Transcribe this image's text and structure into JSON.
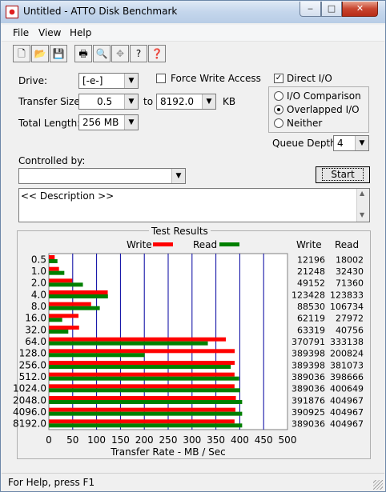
{
  "window": {
    "title": "Untitled - ATTO Disk Benchmark",
    "close_glyph": "✕",
    "max_glyph": "□",
    "min_glyph": "‒"
  },
  "menu": {
    "file": "File",
    "view": "View",
    "help": "Help"
  },
  "toolbar": {
    "icons": [
      "new-icon",
      "open-icon",
      "save-icon",
      "print-icon",
      "print-preview-icon",
      "move-icon",
      "help-icon",
      "context-help-icon"
    ],
    "glyphs": [
      "🗋",
      "📂",
      "💾",
      "🖶",
      "🔍",
      "✥",
      "?",
      "❓"
    ]
  },
  "form": {
    "drive_label": "Drive:",
    "drive_value": "[-e-]",
    "transfer_size_label": "Transfer Size:",
    "transfer_from": "0.5",
    "to_label": "to",
    "transfer_to": "8192.0",
    "unit": "KB",
    "total_length_label": "Total Length:",
    "total_length_value": "256 MB",
    "force_write_label": "Force Write Access",
    "force_write_checked": false,
    "direct_io_label": "Direct I/O",
    "direct_io_checked": true,
    "io_comparison_label": "I/O Comparison",
    "overlapped_io_label": "Overlapped I/O",
    "neither_label": "Neither",
    "selected_mode": "Overlapped I/O",
    "queue_depth_label": "Queue Depth:",
    "queue_depth_value": "4",
    "controlled_by_label": "Controlled by:",
    "controlled_by_value": "",
    "start_label": "Start",
    "description": "<< Description >>",
    "check_glyph": "✓",
    "dropdown_glyph": "▼",
    "scroll_up": "▲",
    "scroll_down": "▼"
  },
  "results": {
    "title": "Test Results",
    "write_legend": "Write",
    "read_legend": "Read",
    "write_header": "Write",
    "read_header": "Read"
  },
  "chart_data": {
    "type": "bar",
    "orientation": "horizontal",
    "categories": [
      "0.5",
      "1.0",
      "2.0",
      "4.0",
      "8.0",
      "16.0",
      "32.0",
      "64.0",
      "128.0",
      "256.0",
      "512.0",
      "1024.0",
      "2048.0",
      "4096.0",
      "8192.0"
    ],
    "series": [
      {
        "name": "Write",
        "color": "#ff0000",
        "values": [
          12.196,
          21.248,
          49.152,
          123.428,
          88.53,
          62.119,
          63.319,
          370.791,
          389.398,
          389.398,
          389.036,
          389.036,
          391.876,
          390.925,
          389.036
        ]
      },
      {
        "name": "Read",
        "color": "#008000",
        "values": [
          18.002,
          32.43,
          71.36,
          123.833,
          106.734,
          27.972,
          40.756,
          333.138,
          200.824,
          381.073,
          398.666,
          400.649,
          404.967,
          404.967,
          404.967
        ]
      }
    ],
    "write_table": [
      "12196",
      "21248",
      "49152",
      "123428",
      "88530",
      "62119",
      "63319",
      "370791",
      "389398",
      "389398",
      "389036",
      "389036",
      "391876",
      "390925",
      "389036"
    ],
    "read_table": [
      "18002",
      "32430",
      "71360",
      "123833",
      "106734",
      "27972",
      "40756",
      "333138",
      "200824",
      "381073",
      "398666",
      "400649",
      "404967",
      "404967",
      "404967"
    ],
    "xticks": [
      "0",
      "50",
      "100",
      "150",
      "200",
      "250",
      "300",
      "350",
      "400",
      "450",
      "500"
    ],
    "xlim": [
      0,
      500
    ],
    "xlabel": "Transfer Rate - MB / Sec",
    "grid": true,
    "grid_color": "#0000a0"
  },
  "status": {
    "text": "For Help, press F1"
  }
}
